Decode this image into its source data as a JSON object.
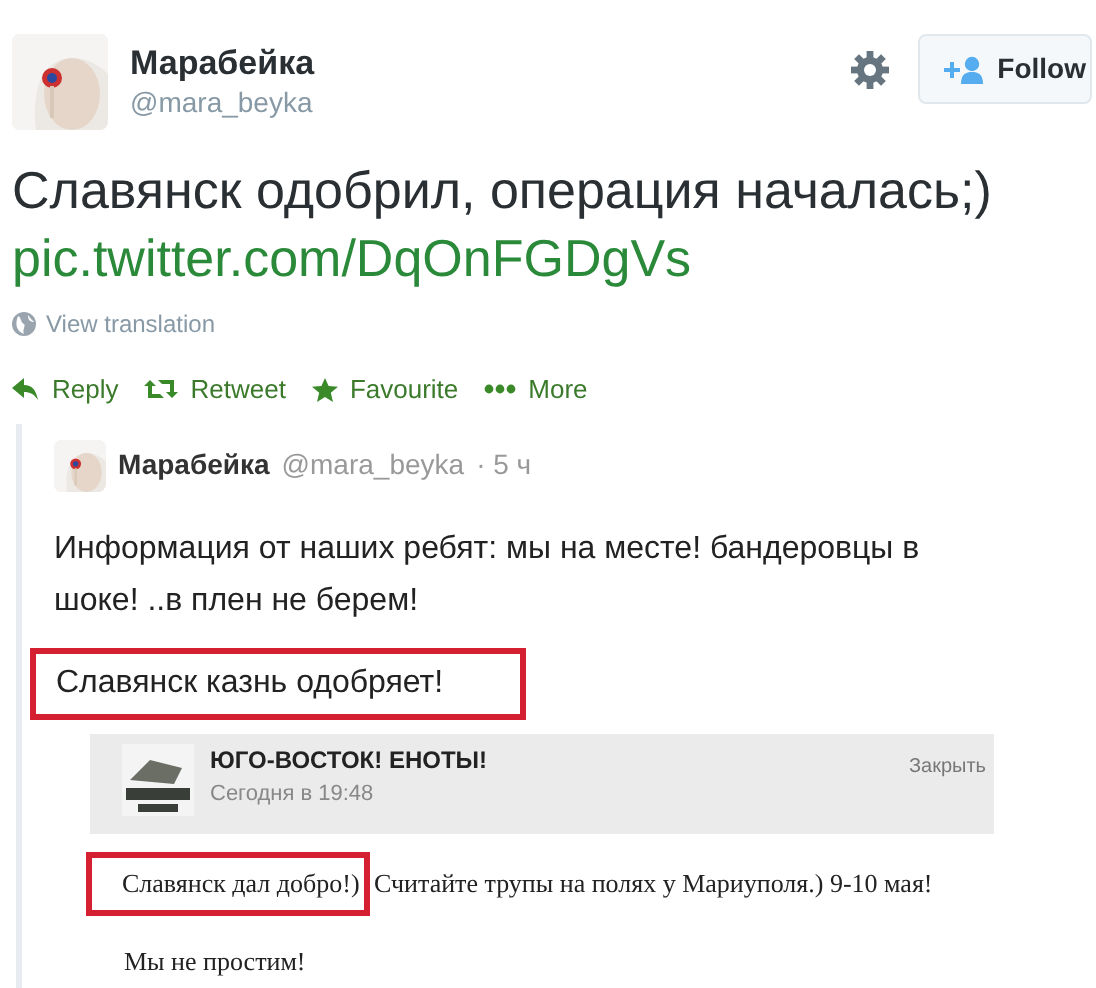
{
  "author": {
    "name": "Марабейка",
    "handle": "@mara_beyka"
  },
  "follow_button": "Follow",
  "tweet_text": "Славянск одобрил, операция началась;)",
  "tweet_link": "pic.twitter.com/DqOnFGDgVs",
  "view_translation": "View translation",
  "actions": [
    {
      "kind": "reply",
      "label": "Reply"
    },
    {
      "kind": "retweet",
      "label": "Retweet"
    },
    {
      "kind": "favourite",
      "label": "Favourite"
    },
    {
      "kind": "more",
      "label": "More"
    }
  ],
  "attached_image": {
    "quoted_tweet": {
      "name": "Марабейка",
      "handle": "@mara_beyka",
      "time": "· 5 ч",
      "text": "Информация от наших ребят: мы на месте! бандеровцы в шоке! ..в плен не берем!",
      "highlighted_text": "Славянск казнь одобряет!"
    },
    "post": {
      "group": "ЮГО-ВОСТОК! ЕНОТЫ!",
      "date": "Сегодня в 19:48",
      "close": "Закрыть",
      "highlighted_text": "Славянск дал добро!)",
      "text": "Считайте трупы на полях у Мариуполя.) 9-10 мая!",
      "closing_text": "Мы не простим!"
    }
  }
}
